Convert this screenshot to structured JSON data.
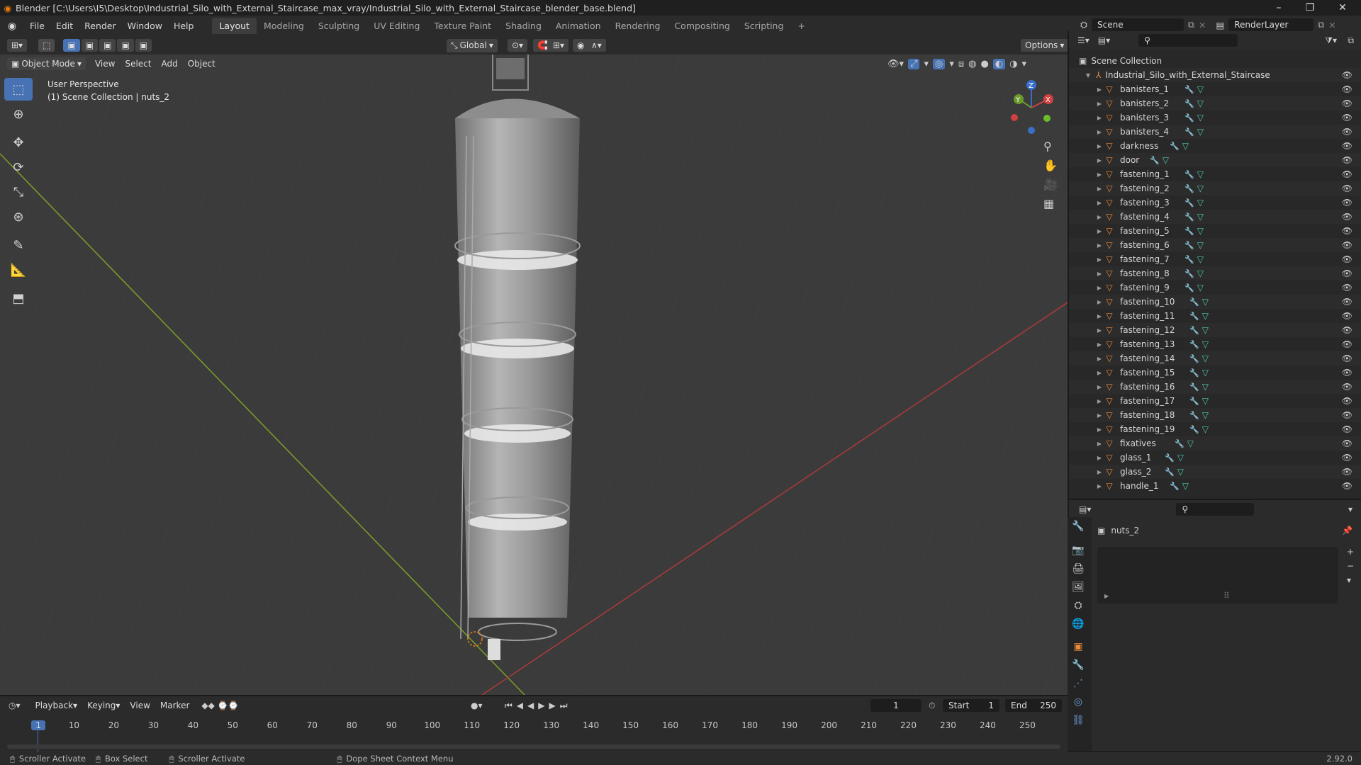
{
  "title": "Blender [C:\\Users\\I5\\Desktop\\Industrial_Silo_with_External_Staircase_max_vray/Industrial_Silo_with_External_Staircase_blender_base.blend]",
  "menu": [
    "File",
    "Edit",
    "Render",
    "Window",
    "Help"
  ],
  "workspaces": [
    "Layout",
    "Modeling",
    "Sculpting",
    "UV Editing",
    "Texture Paint",
    "Shading",
    "Animation",
    "Rendering",
    "Compositing",
    "Scripting"
  ],
  "active_workspace": "Layout",
  "scene": {
    "label": "Scene",
    "render_layer": "RenderLayer"
  },
  "header": {
    "transform_orientation": "Global",
    "options": "Options"
  },
  "viewport_menu": {
    "mode": "Object Mode",
    "view": "View",
    "select": "Select",
    "add": "Add",
    "object": "Object"
  },
  "viewport": {
    "perspective": "User Perspective",
    "collection_info": "(1) Scene Collection | nuts_2"
  },
  "gizmo": {
    "x": "X",
    "y": "Y",
    "z": "Z"
  },
  "outliner": {
    "root": "Scene Collection",
    "collection": "Industrial_Silo_with_External_Staircase",
    "items": [
      "banisters_1",
      "banisters_2",
      "banisters_3",
      "banisters_4",
      "darkness",
      "door",
      "fastening_1",
      "fastening_2",
      "fastening_3",
      "fastening_4",
      "fastening_5",
      "fastening_6",
      "fastening_7",
      "fastening_8",
      "fastening_9",
      "fastening_10",
      "fastening_11",
      "fastening_12",
      "fastening_13",
      "fastening_14",
      "fastening_15",
      "fastening_16",
      "fastening_17",
      "fastening_18",
      "fastening_19",
      "fixatives",
      "glass_1",
      "glass_2",
      "handle_1"
    ]
  },
  "properties": {
    "object_name": "nuts_2"
  },
  "timeline": {
    "menus": [
      "Playback",
      "Keying",
      "View",
      "Marker"
    ],
    "current_frame": "1",
    "start_label": "Start",
    "start": "1",
    "end_label": "End",
    "end": "250",
    "ticks": [
      "1",
      "10",
      "20",
      "30",
      "40",
      "50",
      "60",
      "70",
      "80",
      "90",
      "100",
      "110",
      "120",
      "130",
      "140",
      "150",
      "160",
      "170",
      "180",
      "190",
      "200",
      "210",
      "220",
      "230",
      "240",
      "250"
    ]
  },
  "status": {
    "a": "Scroller Activate",
    "b": "Box Select",
    "c": "Scroller Activate",
    "d": "Dope Sheet Context Menu",
    "version": "2.92.0"
  }
}
